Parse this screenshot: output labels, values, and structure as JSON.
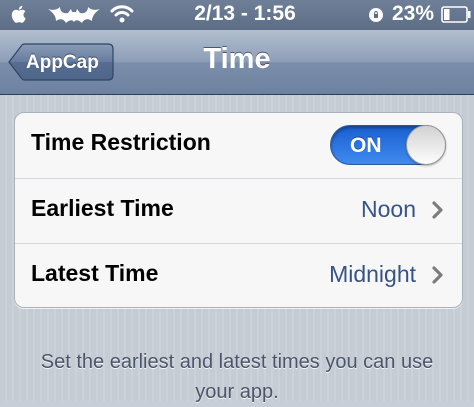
{
  "status_bar": {
    "datetime": "2/13 - 1:56",
    "battery_percent": "23%",
    "icons": [
      "apple-icon",
      "batman-logo-icon",
      "wifi-icon",
      "orientation-lock-icon",
      "battery-icon"
    ]
  },
  "nav": {
    "back_label": "AppCap",
    "title": "Time"
  },
  "settings": {
    "rows": [
      {
        "label": "Time Restriction",
        "toggle_state": "ON"
      },
      {
        "label": "Earliest Time",
        "value": "Noon"
      },
      {
        "label": "Latest Time",
        "value": "Midnight"
      }
    ]
  },
  "footer": {
    "text": "Set the earliest and latest times you can use your app."
  },
  "colors": {
    "toggle_on": "#3f8bf0",
    "value_text": "#385487",
    "nav_bar": "#7b8eaa"
  }
}
